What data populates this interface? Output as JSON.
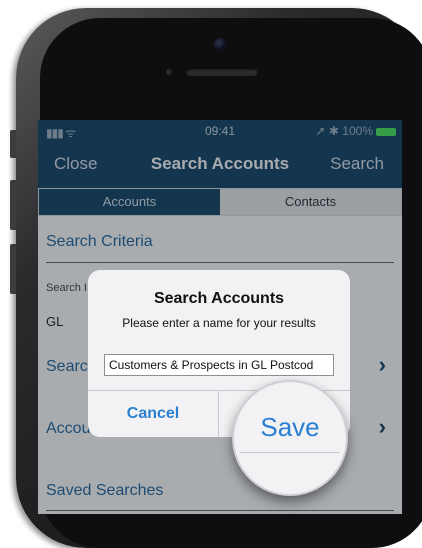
{
  "status_bar": {
    "signal": "▮▮▮",
    "wifi": "ᯤ",
    "time": "09:41",
    "right": "➚ ✱ 100%"
  },
  "nav": {
    "close_label": "Close",
    "title": "Search Accounts",
    "search_label": "Search"
  },
  "segments": {
    "accounts": "Accounts",
    "contacts": "Contacts"
  },
  "content": {
    "search_criteria": "Search Criteria",
    "search_label": "Search I",
    "search_value": "GL",
    "search_link": "Searc",
    "account_link": "Accou",
    "saved_searches": "Saved Searches"
  },
  "alert": {
    "title": "Search Accounts",
    "message": "Please enter a name for your results",
    "input_value": "Customers & Prospects in GL Postcod",
    "cancel_label": "Cancel",
    "save_label": "Save"
  },
  "icons": {
    "chevron": "›"
  },
  "colors": {
    "nav_bg": "#1b4a6d",
    "link_blue": "#2a6aa0",
    "ios_blue": "#2a7fd3",
    "battery_green": "#4cd964"
  }
}
